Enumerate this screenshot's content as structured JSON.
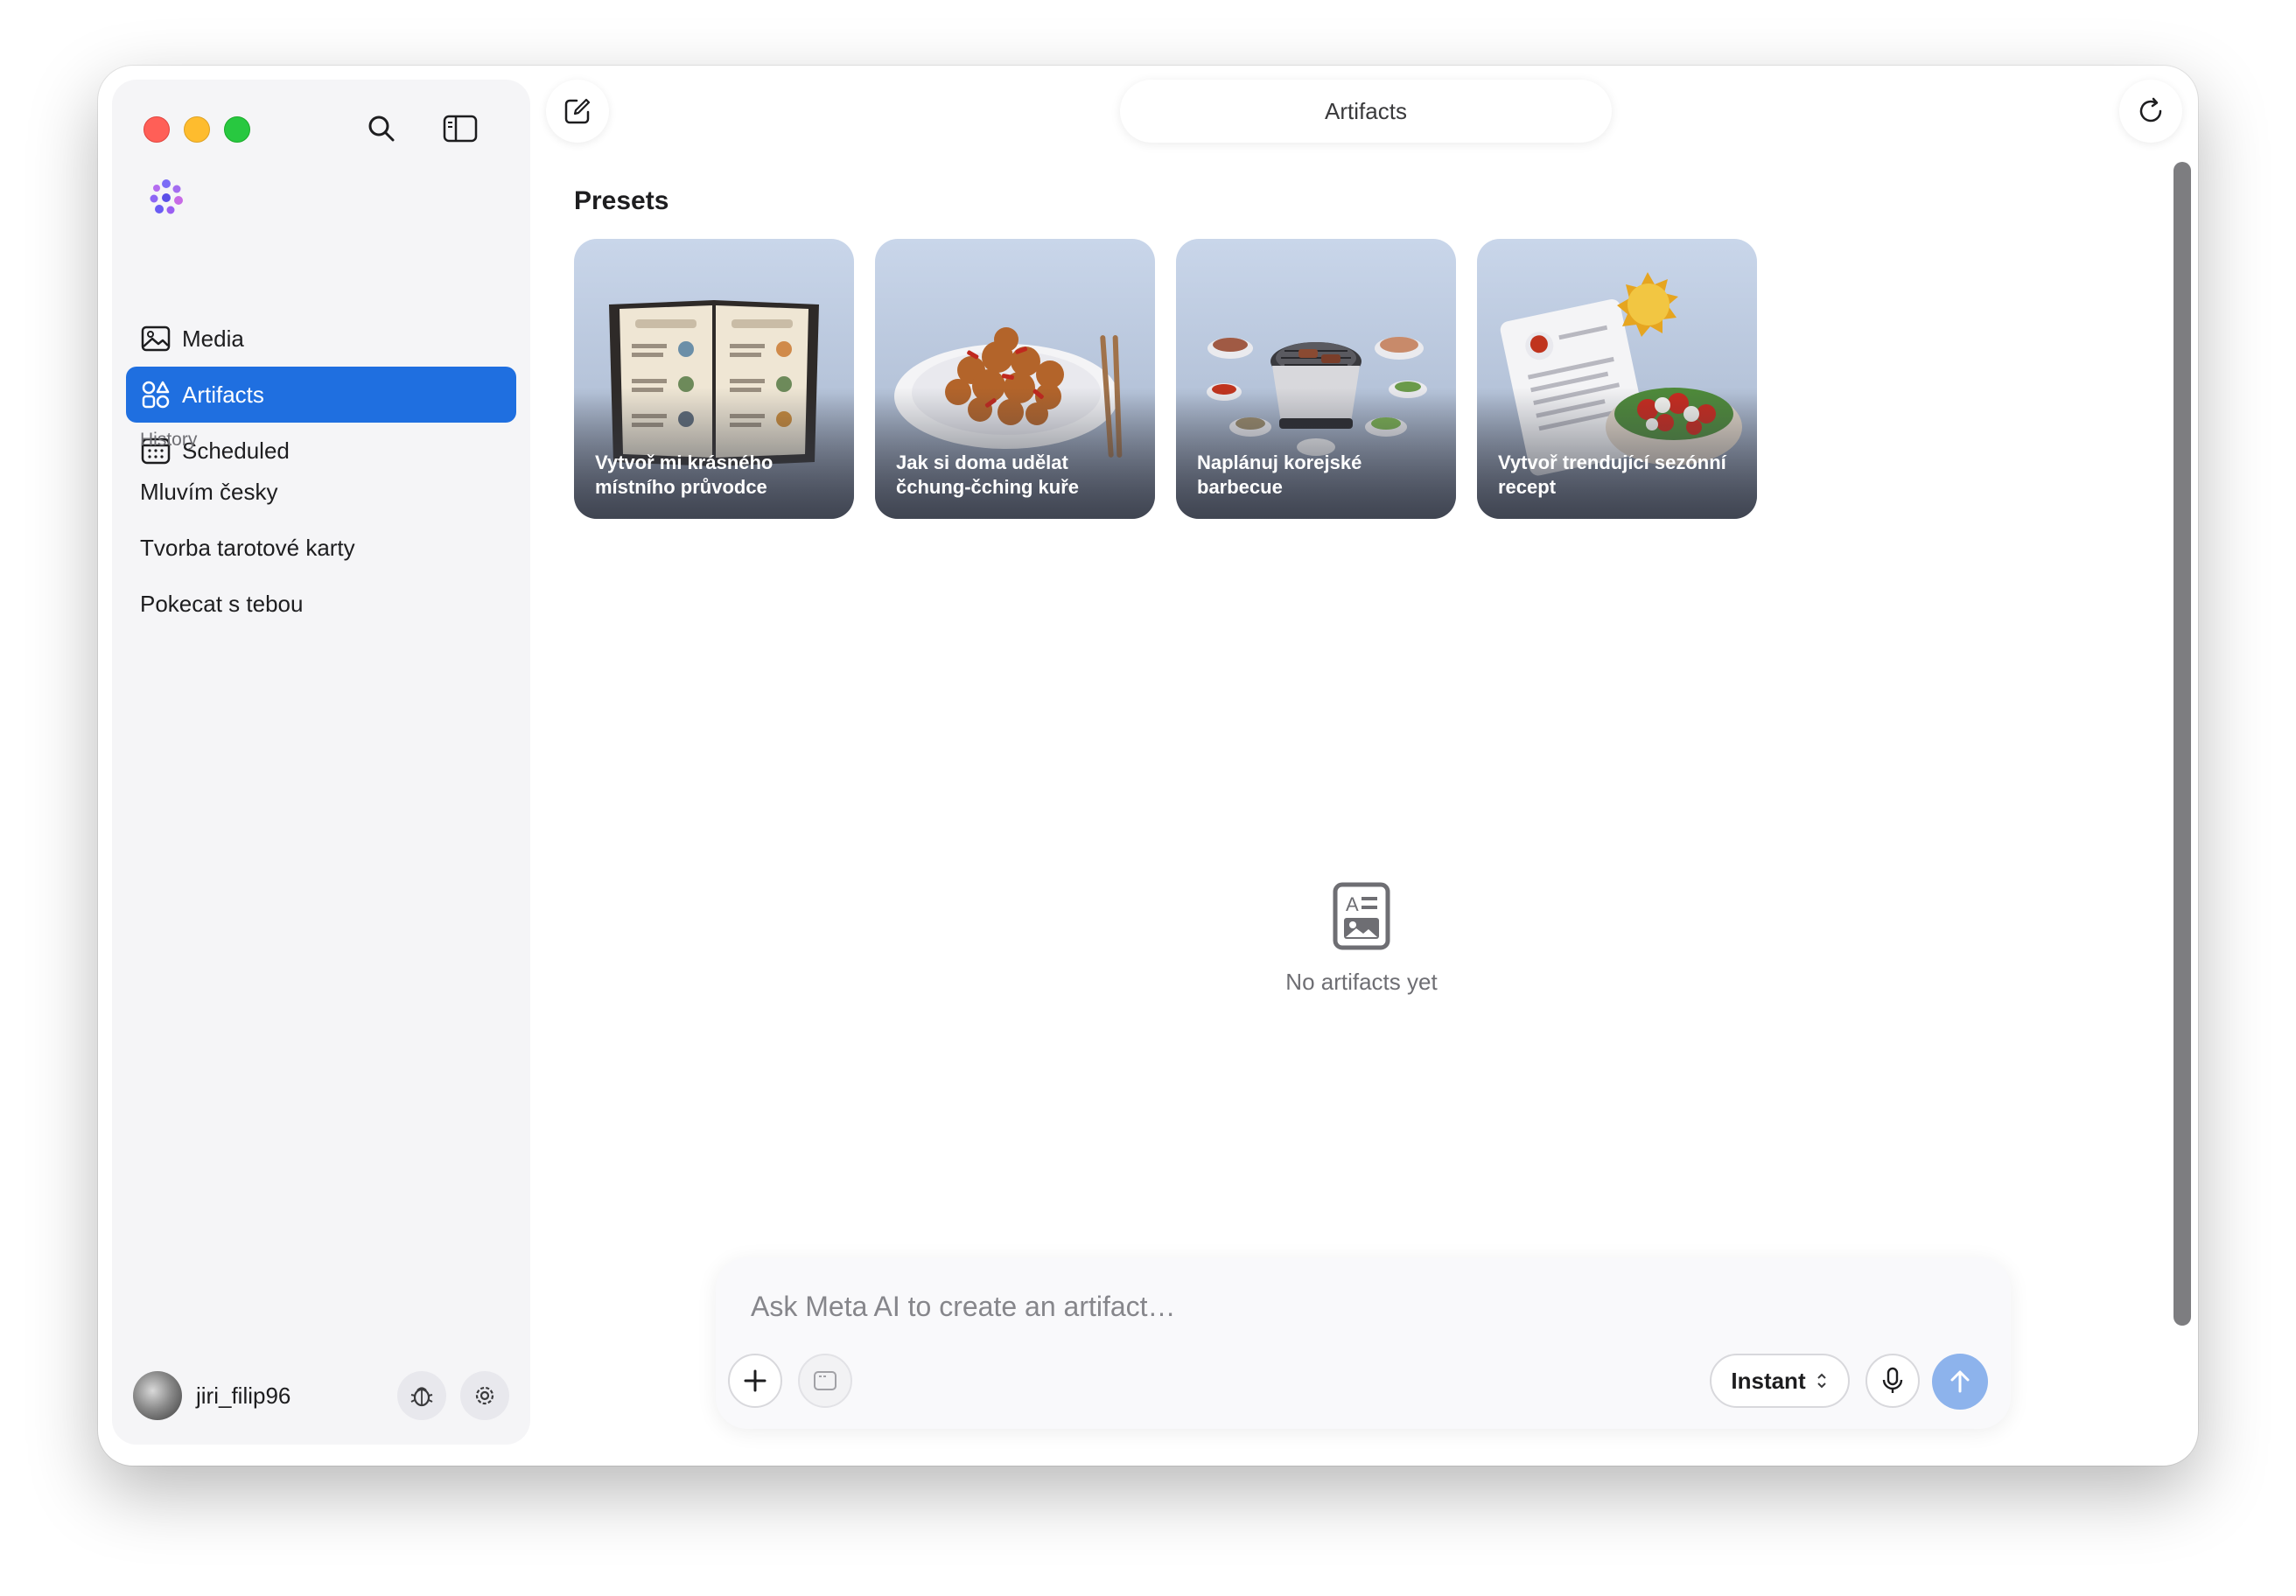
{
  "window": {
    "title": "Artifacts"
  },
  "sidebar": {
    "nav": [
      {
        "label": "Media",
        "icon": "image-icon",
        "active": false
      },
      {
        "label": "Artifacts",
        "icon": "shapes-icon",
        "active": true
      },
      {
        "label": "Scheduled",
        "icon": "calendar-icon",
        "active": false
      }
    ],
    "history_label": "History",
    "history": [
      {
        "label": "Mluvím česky"
      },
      {
        "label": "Tvorba tarotové karty"
      },
      {
        "label": "Pokecat s tebou"
      }
    ],
    "user": {
      "name": "jiri_filip96"
    }
  },
  "main": {
    "presets_title": "Presets",
    "presets": [
      {
        "label": "Vytvoř mi krásného místního průvodce"
      },
      {
        "label": "Jak si doma udělat čchung-čching kuře"
      },
      {
        "label": "Naplánuj korejské barbecue"
      },
      {
        "label": "Vytvoř trendující sezónní recept"
      }
    ],
    "empty_text": "No artifacts yet"
  },
  "composer": {
    "placeholder": "Ask Meta AI to create an artifact…",
    "value": "",
    "mode": "Instant"
  },
  "colors": {
    "accent": "#1f6fe0",
    "send_button": "#8db3ec"
  }
}
